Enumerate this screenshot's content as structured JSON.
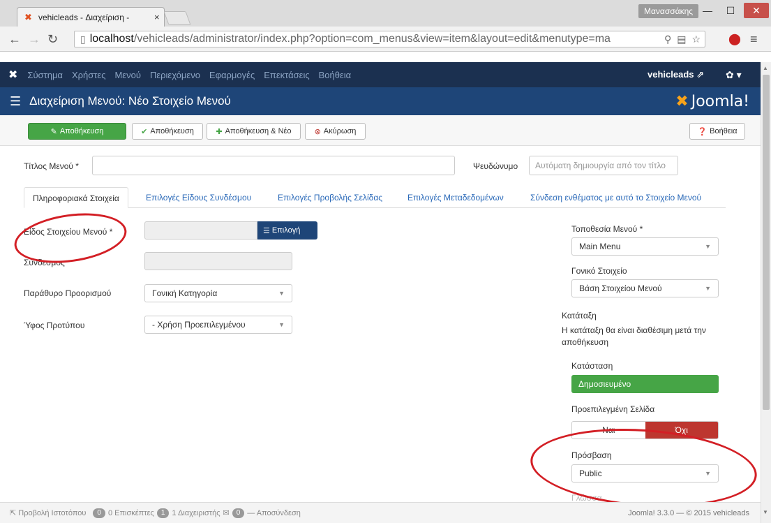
{
  "browser": {
    "tab_title": "vehicleads - Διαχείριση - ",
    "user_name": "Μανασσάκης",
    "url_host": "localhost",
    "url_path": "/vehicleads/administrator/index.php?option=com_menus&view=item&layout=edit&menutype=ma"
  },
  "topnav": {
    "items": [
      "Σύστημα",
      "Χρήστες",
      "Μενού",
      "Περιεχόμενο",
      "Εφαρμογές",
      "Επεκτάσεις",
      "Βοήθεια"
    ],
    "site_link": "vehicleads",
    "gear": "gear-icon"
  },
  "header": {
    "title": "Διαχείριση Μενού: Νέο Στοιχείο Μενού",
    "brand": "Joomla!"
  },
  "toolbar": {
    "save": "Αποθήκευση",
    "save_close": "Αποθήκευση",
    "save_new": "Αποθήκευση & Νέο",
    "cancel": "Ακύρωση",
    "help": "Βοήθεια"
  },
  "form": {
    "title_label": "Τίτλος Μενού *",
    "title_value": "",
    "alias_label": "Ψευδώνυμο",
    "alias_placeholder": "Αυτόματη δημιουργία από τον τίτλο",
    "tabs": [
      "Πληροφοριακά Στοιχεία",
      "Επιλογές Είδους Συνδέσμου",
      "Επιλογές Προβολής Σελίδας",
      "Επιλογές Μεταδεδομένων",
      "Σύνδεση ενθέματος με αυτό το Στοιχείο Μενού"
    ],
    "menu_item_type_label": "Είδος Στοιχείου Μενού *",
    "select_button": "Επιλογή",
    "link_label": "Σύνδεσμος",
    "target_window_label": "Παράθυρο Προορισμού",
    "target_window_value": "Γονική Κατηγορία",
    "template_style_label": "Ύφος Προτύπου",
    "template_style_value": "- Χρήση Προεπιλεγμένου",
    "menu_location_label": "Τοποθεσία Μενού *",
    "menu_location_value": "Main Menu",
    "parent_item_label": "Γονικό Στοιχείο",
    "parent_item_value": "Βάση Στοιχείου Μενού",
    "ordering_label": "Κατάταξη",
    "ordering_text": "Η κατάταξη θα είναι διαθέσιμη μετά την αποθήκευση",
    "status_label": "Κατάσταση",
    "status_value": "Δημοσιευμένο",
    "default_page_label": "Προεπιλεγμένη Σελίδα",
    "default_yes": "Ναι",
    "default_no": "Όχι",
    "access_label": "Πρόσβαση",
    "access_value": "Public",
    "language_label": "Γλώσσα"
  },
  "statusbar": {
    "view_site": "Προβολή Ιστοτόπου",
    "visitors_count": "0",
    "visitors_label": "0 Επισκέπτες",
    "admins_count": "1",
    "admins_label": "1 Διαχειριστής",
    "messages_count": "0",
    "logout": "Αποσύνδεση",
    "version": "Joomla! 3.3.0 — © 2015 vehicleads"
  },
  "annotation_color": "#d31f25"
}
